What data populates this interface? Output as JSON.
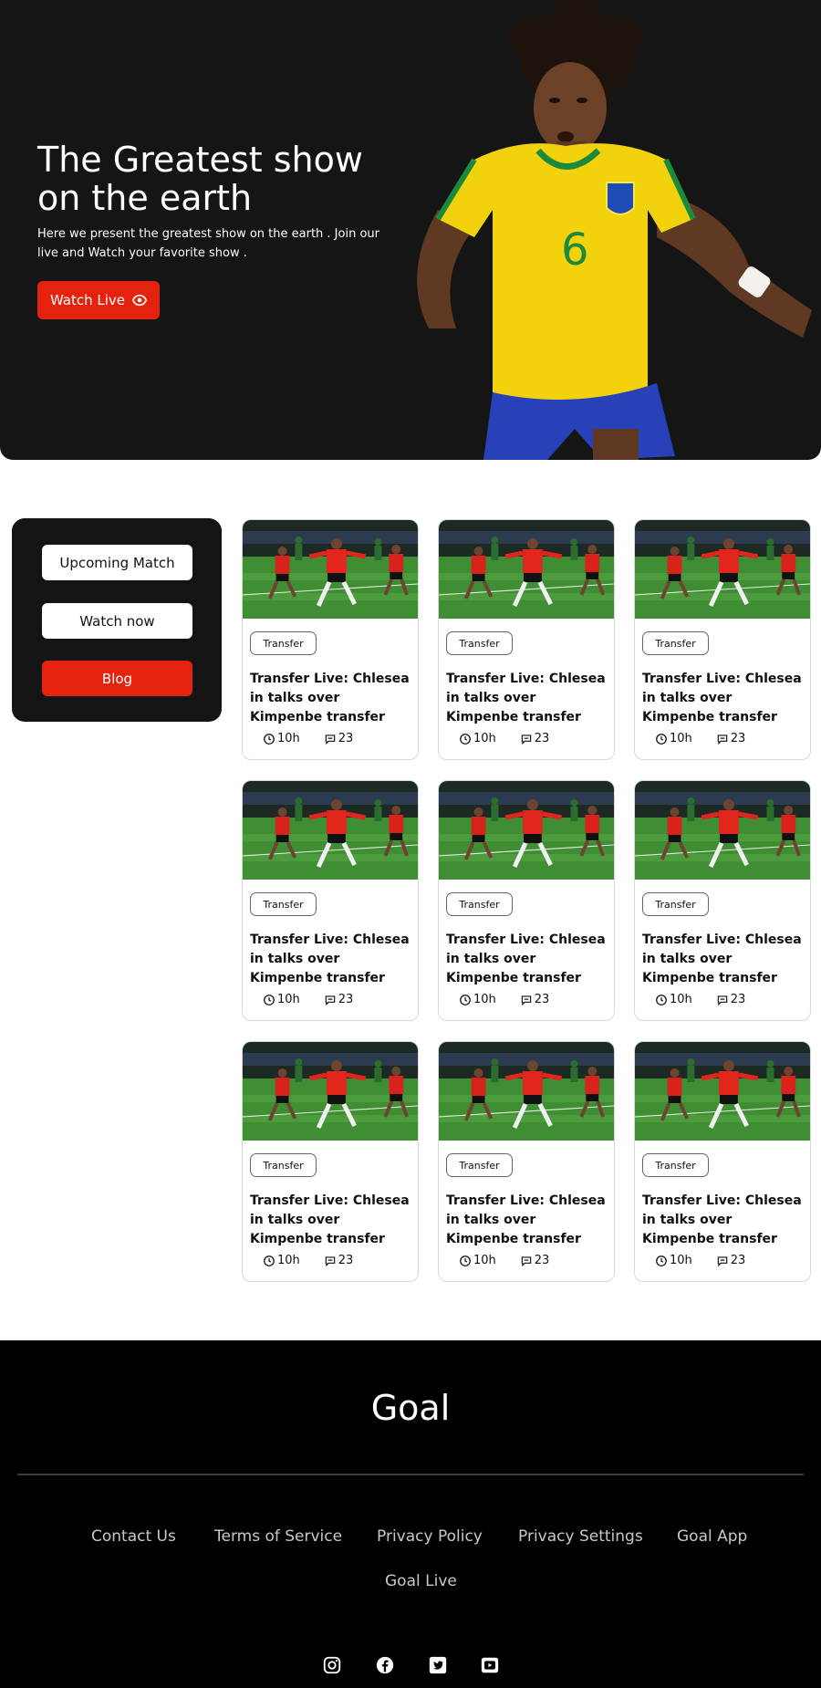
{
  "hero": {
    "title": "The Greatest show on the earth",
    "description": "Here we present the greatest show on the earth . Join our live and Watch your favorite show .",
    "cta_label": "Watch Live",
    "cta_icon": "eye-icon",
    "accent_color": "#e5220e",
    "background_color": "#151516"
  },
  "sidebar": {
    "items": [
      {
        "label": "Upcoming Match",
        "active": false
      },
      {
        "label": "Watch now",
        "active": false
      },
      {
        "label": "Blog",
        "active": true
      }
    ]
  },
  "cards": [
    {
      "tag": "Transfer",
      "title": "Transfer Live: Chlesea in talks over Kimpenbe transfer",
      "time": "10h",
      "comments": "23"
    },
    {
      "tag": "Transfer",
      "title": "Transfer Live: Chlesea in talks over Kimpenbe transfer",
      "time": "10h",
      "comments": "23"
    },
    {
      "tag": "Transfer",
      "title": "Transfer Live: Chlesea in talks over Kimpenbe transfer",
      "time": "10h",
      "comments": "23"
    },
    {
      "tag": "Transfer",
      "title": "Transfer Live: Chlesea in talks over Kimpenbe transfer",
      "time": "10h",
      "comments": "23"
    },
    {
      "tag": "Transfer",
      "title": "Transfer Live: Chlesea in talks over Kimpenbe transfer",
      "time": "10h",
      "comments": "23"
    },
    {
      "tag": "Transfer",
      "title": "Transfer Live: Chlesea in talks over Kimpenbe transfer",
      "time": "10h",
      "comments": "23"
    },
    {
      "tag": "Transfer",
      "title": "Transfer Live: Chlesea in talks over Kimpenbe transfer",
      "time": "10h",
      "comments": "23"
    },
    {
      "tag": "Transfer",
      "title": "Transfer Live: Chlesea in talks over Kimpenbe transfer",
      "time": "10h",
      "comments": "23"
    },
    {
      "tag": "Transfer",
      "title": "Transfer Live: Chlesea in talks over Kimpenbe transfer",
      "time": "10h",
      "comments": "23"
    }
  ],
  "footer": {
    "logo": "Goal",
    "links": [
      "Contact Us",
      "Terms of Service",
      "Privacy Policy",
      "Privacy Settings",
      "Goal App",
      "Goal Live"
    ],
    "social": [
      "instagram-icon",
      "facebook-icon",
      "twitter-icon",
      "youtube-icon"
    ]
  }
}
